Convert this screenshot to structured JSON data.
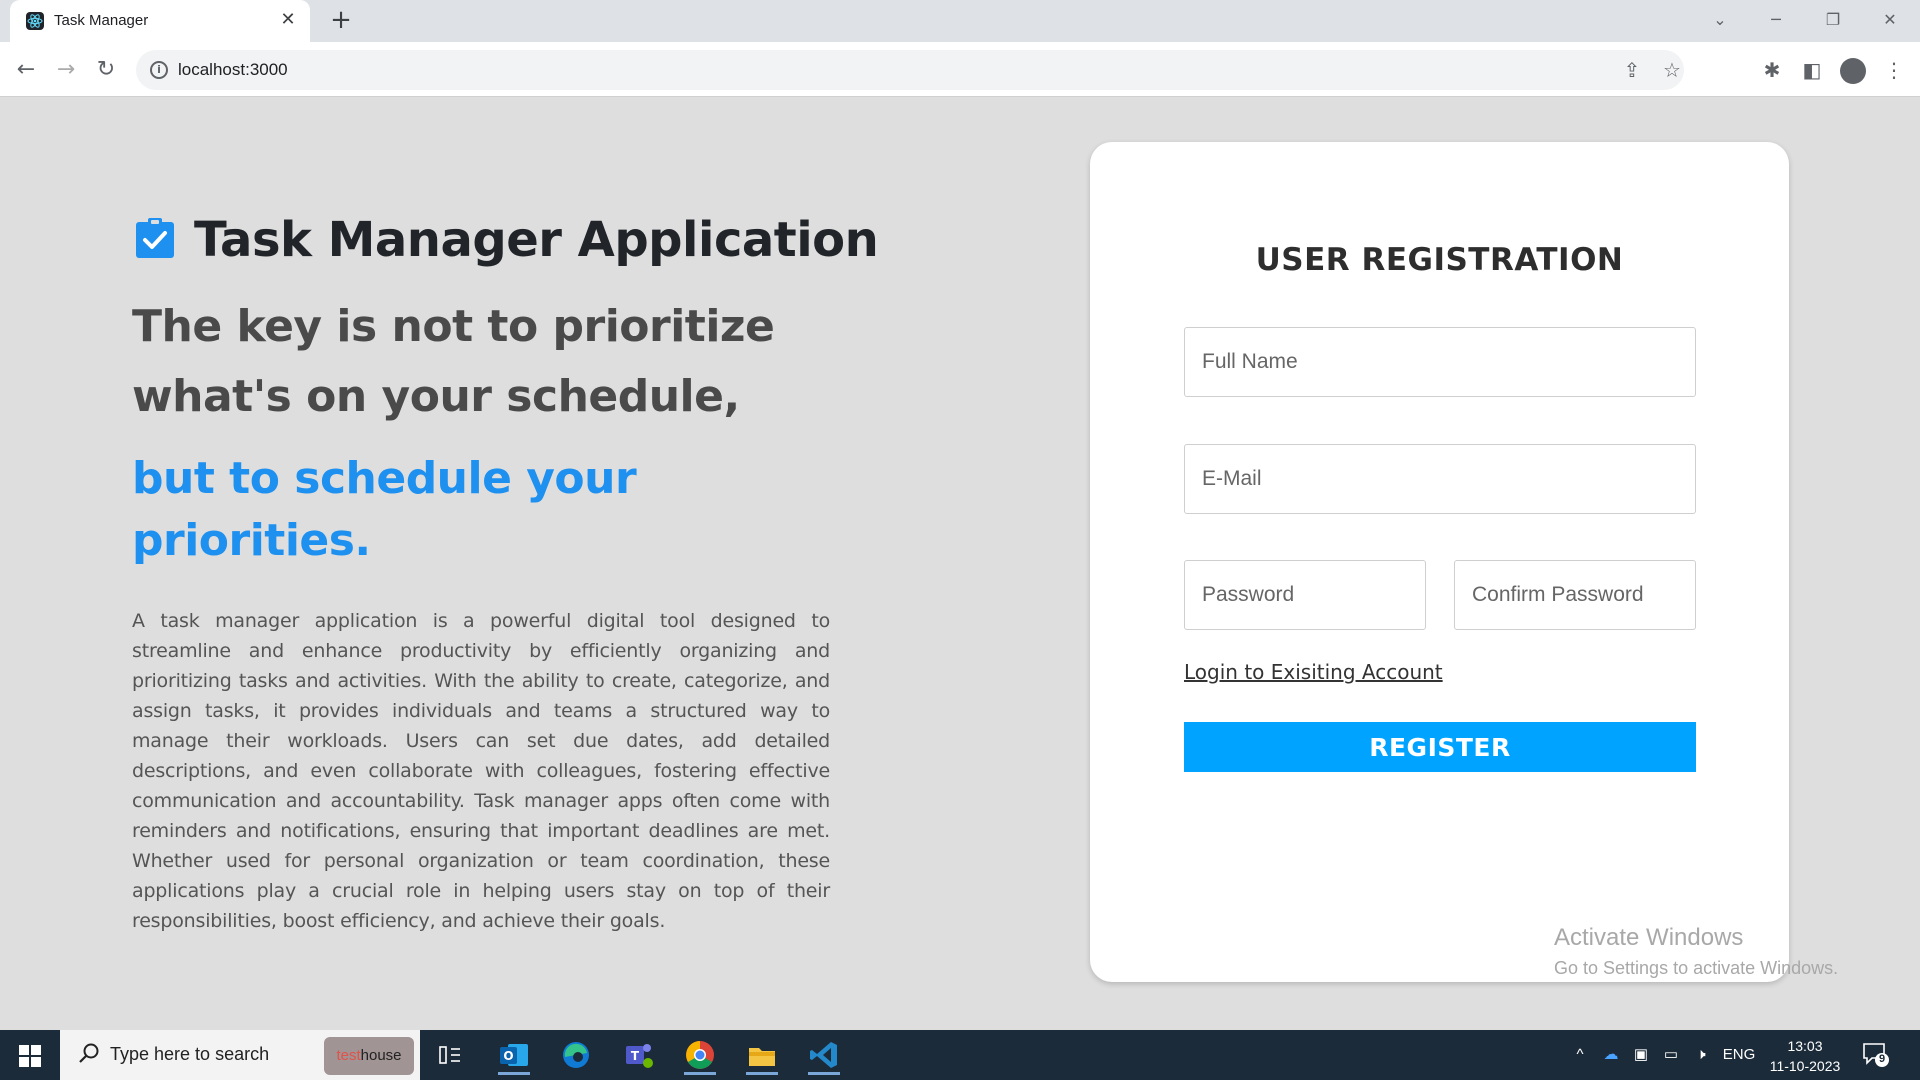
{
  "browser": {
    "tab_title": "Task Manager",
    "url": "localhost:3000"
  },
  "left": {
    "app_title": "Task Manager Application",
    "quote_line1": "The key is not to prioritize what's on your schedule,",
    "quote_line2": "but to schedule your priorities.",
    "description": "A task manager application is a powerful digital tool designed to streamline and enhance productivity by efficiently organizing and prioritizing tasks and activities. With the ability to create, categorize, and assign tasks, it provides individuals and teams a structured way to manage their workloads. Users can set due dates, add detailed descriptions, and even collaborate with colleagues, fostering effective communication and accountability. Task manager apps often come with reminders and notifications, ensuring that important deadlines are met. Whether used for personal organization or team coordination, these applications play a crucial role in helping users stay on top of their responsibilities, boost efficiency, and achieve their goals."
  },
  "form": {
    "title": "USER REGISTRATION",
    "full_name_placeholder": "Full Name",
    "email_placeholder": "E-Mail",
    "password_placeholder": "Password",
    "confirm_password_placeholder": "Confirm Password",
    "login_link": "Login to Exisiting Account",
    "register_label": "REGISTER"
  },
  "watermark": {
    "line1": "Activate Windows",
    "line2": "Go to Settings to activate Windows."
  },
  "taskbar": {
    "search_placeholder": "Type here to search",
    "search_badge_a": "test",
    "search_badge_b": "house",
    "language": "ENG",
    "time": "13:03",
    "date": "11-10-2023",
    "notification_count": "9"
  },
  "colors": {
    "accent": "#00a3ff",
    "quote_blue": "#1e90ef",
    "page_bg": "#dedede"
  }
}
